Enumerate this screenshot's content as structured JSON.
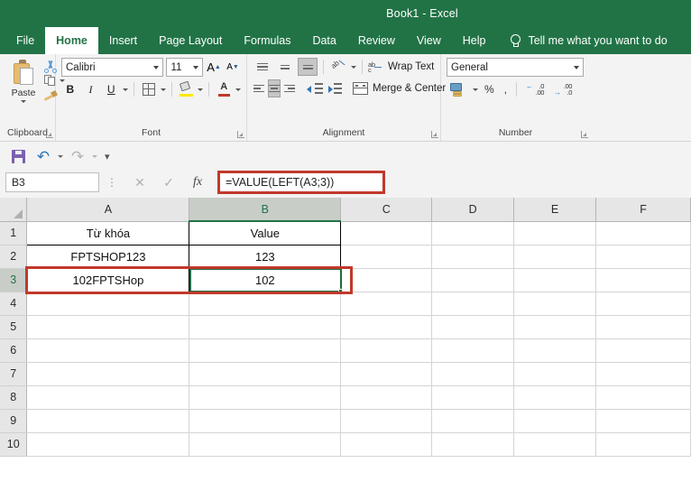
{
  "titlebar": {
    "title": "Book1  -  Excel"
  },
  "tabs": [
    {
      "label": "File",
      "active": false
    },
    {
      "label": "Home",
      "active": true
    },
    {
      "label": "Insert",
      "active": false
    },
    {
      "label": "Page Layout",
      "active": false
    },
    {
      "label": "Formulas",
      "active": false
    },
    {
      "label": "Data",
      "active": false
    },
    {
      "label": "Review",
      "active": false
    },
    {
      "label": "View",
      "active": false
    },
    {
      "label": "Help",
      "active": false
    }
  ],
  "tellme": {
    "label": "Tell me what you want to do",
    "icon": "lightbulb-icon"
  },
  "ribbon": {
    "clipboard": {
      "group_label": "Clipboard",
      "paste_label": "Paste",
      "cut_icon": "scissors-icon",
      "copy_icon": "copy-icon",
      "format_painter_icon": "format-painter-icon"
    },
    "font": {
      "group_label": "Font",
      "font_name": "Calibri",
      "font_size": "11",
      "grow_label": "A",
      "shrink_label": "A",
      "bold_label": "B",
      "italic_label": "I",
      "underline_label": "U",
      "borders_icon": "borders-icon",
      "fill_color_icon": "fill-color-icon",
      "font_color_label": "A"
    },
    "alignment": {
      "group_label": "Alignment",
      "wrap_text_label": "Wrap Text",
      "merge_center_label": "Merge & Center",
      "orientation_icon": "orientation-icon",
      "decrease_indent_icon": "decrease-indent-icon",
      "increase_indent_icon": "increase-indent-icon"
    },
    "number": {
      "group_label": "Number",
      "format": "General",
      "accounting_icon": "accounting-format-icon",
      "percent_label": "%",
      "comma_label": ",",
      "increase_decimal_icon": "increase-decimal-icon",
      "decrease_decimal_icon": "decrease-decimal-icon"
    }
  },
  "qat": {
    "save_icon": "save-icon",
    "undo_icon": "undo-icon",
    "redo_icon": "redo-icon",
    "customize_icon": "customize-qat-icon"
  },
  "formula_bar": {
    "name_box": "B3",
    "cancel_label": "✕",
    "enter_label": "✓",
    "fx_label": "fx",
    "formula": "=VALUE(LEFT(A3;3))",
    "highlight_color": "#c0392b"
  },
  "sheet": {
    "columns": [
      "A",
      "B",
      "C",
      "D",
      "E",
      "F"
    ],
    "active_column": "B",
    "active_row": 3,
    "rows": [
      {
        "num": "1",
        "cells": [
          "Từ khóa",
          "Value",
          "",
          "",
          "",
          ""
        ]
      },
      {
        "num": "2",
        "cells": [
          "FPTSHOP123",
          "123",
          "",
          "",
          "",
          ""
        ]
      },
      {
        "num": "3",
        "cells": [
          "102FPTSHop",
          "102",
          "",
          "",
          "",
          ""
        ]
      },
      {
        "num": "4",
        "cells": [
          "",
          "",
          "",
          "",
          "",
          ""
        ]
      },
      {
        "num": "5",
        "cells": [
          "",
          "",
          "",
          "",
          "",
          ""
        ]
      },
      {
        "num": "6",
        "cells": [
          "",
          "",
          "",
          "",
          "",
          ""
        ]
      },
      {
        "num": "7",
        "cells": [
          "",
          "",
          "",
          "",
          "",
          ""
        ]
      },
      {
        "num": "8",
        "cells": [
          "",
          "",
          "",
          "",
          "",
          ""
        ]
      },
      {
        "num": "9",
        "cells": [
          "",
          "",
          "",
          "",
          "",
          ""
        ]
      },
      {
        "num": "10",
        "cells": [
          "",
          "",
          "",
          "",
          "",
          ""
        ]
      }
    ],
    "selected_cell": "B3",
    "selection_color": "#1e6b42",
    "row_highlight_color": "#c0392b"
  }
}
